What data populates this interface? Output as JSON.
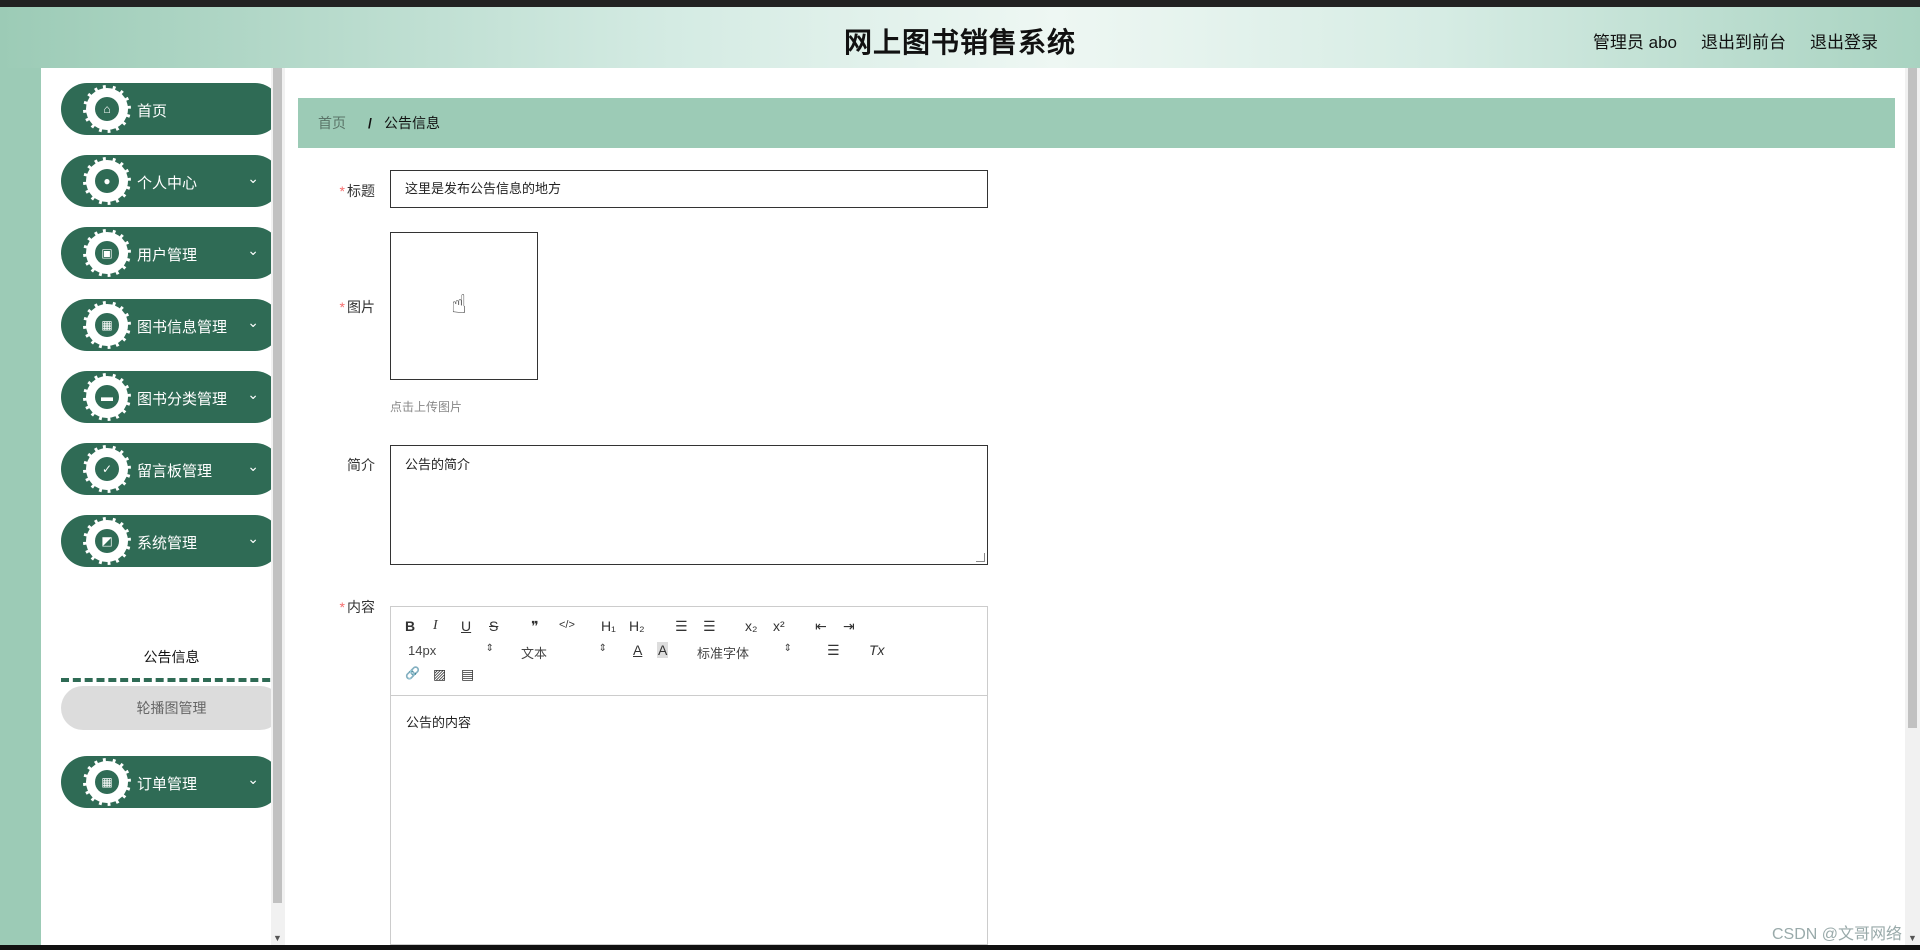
{
  "header": {
    "title": "网上图书销售系统",
    "admin": "管理员 abo",
    "to_front": "退出到前台",
    "logout": "退出登录"
  },
  "sidebar": {
    "items": [
      {
        "label": "首页",
        "icon": "home-icon",
        "glyph": "⌂",
        "has_chevron": false
      },
      {
        "label": "个人中心",
        "icon": "user-icon",
        "glyph": "●",
        "has_chevron": true
      },
      {
        "label": "用户管理",
        "icon": "wallet-icon",
        "glyph": "▣",
        "has_chevron": true
      },
      {
        "label": "图书信息管理",
        "icon": "grid-icon",
        "glyph": "▦",
        "has_chevron": true
      },
      {
        "label": "图书分类管理",
        "icon": "monitor-icon",
        "glyph": "▬",
        "has_chevron": true
      },
      {
        "label": "留言板管理",
        "icon": "clipboard-icon",
        "glyph": "✓",
        "has_chevron": true
      },
      {
        "label": "系统管理",
        "icon": "chart-icon",
        "glyph": "◩",
        "has_chevron": true
      },
      {
        "label": "订单管理",
        "icon": "grid-icon",
        "glyph": "▦",
        "has_chevron": true
      }
    ],
    "submenu": {
      "active": "公告信息",
      "other": "轮播图管理"
    },
    "chevron": "⌄"
  },
  "breadcrumb": {
    "home": "首页",
    "separator": "/",
    "current": "公告信息"
  },
  "form": {
    "title_label": "标题",
    "title_value": "这里是发布公告信息的地方",
    "image_label": "图片",
    "image_hint": "点击上传图片",
    "intro_label": "简介",
    "intro_value": "公告的简介",
    "content_label": "内容",
    "content_value": "公告的内容",
    "required_mark": "*"
  },
  "editor": {
    "font_size": "14px",
    "header_type": "文本",
    "font_family": "标准字体",
    "buttons": {
      "bold": "B",
      "italic": "I",
      "underline": "U",
      "strike": "S",
      "quote": "❞",
      "code": "</>",
      "h1": "H₁",
      "h2": "H₂",
      "ordered": "☰",
      "bullet": "☰",
      "sub": "x₂",
      "sup": "x²",
      "outdent": "⇤",
      "indent": "⇥",
      "color": "A",
      "background": "A",
      "align": "☰",
      "clean": "Tx",
      "link": "🔗",
      "image": "▨",
      "video": "▤"
    }
  },
  "watermark": "CSDN @文哥网络"
}
